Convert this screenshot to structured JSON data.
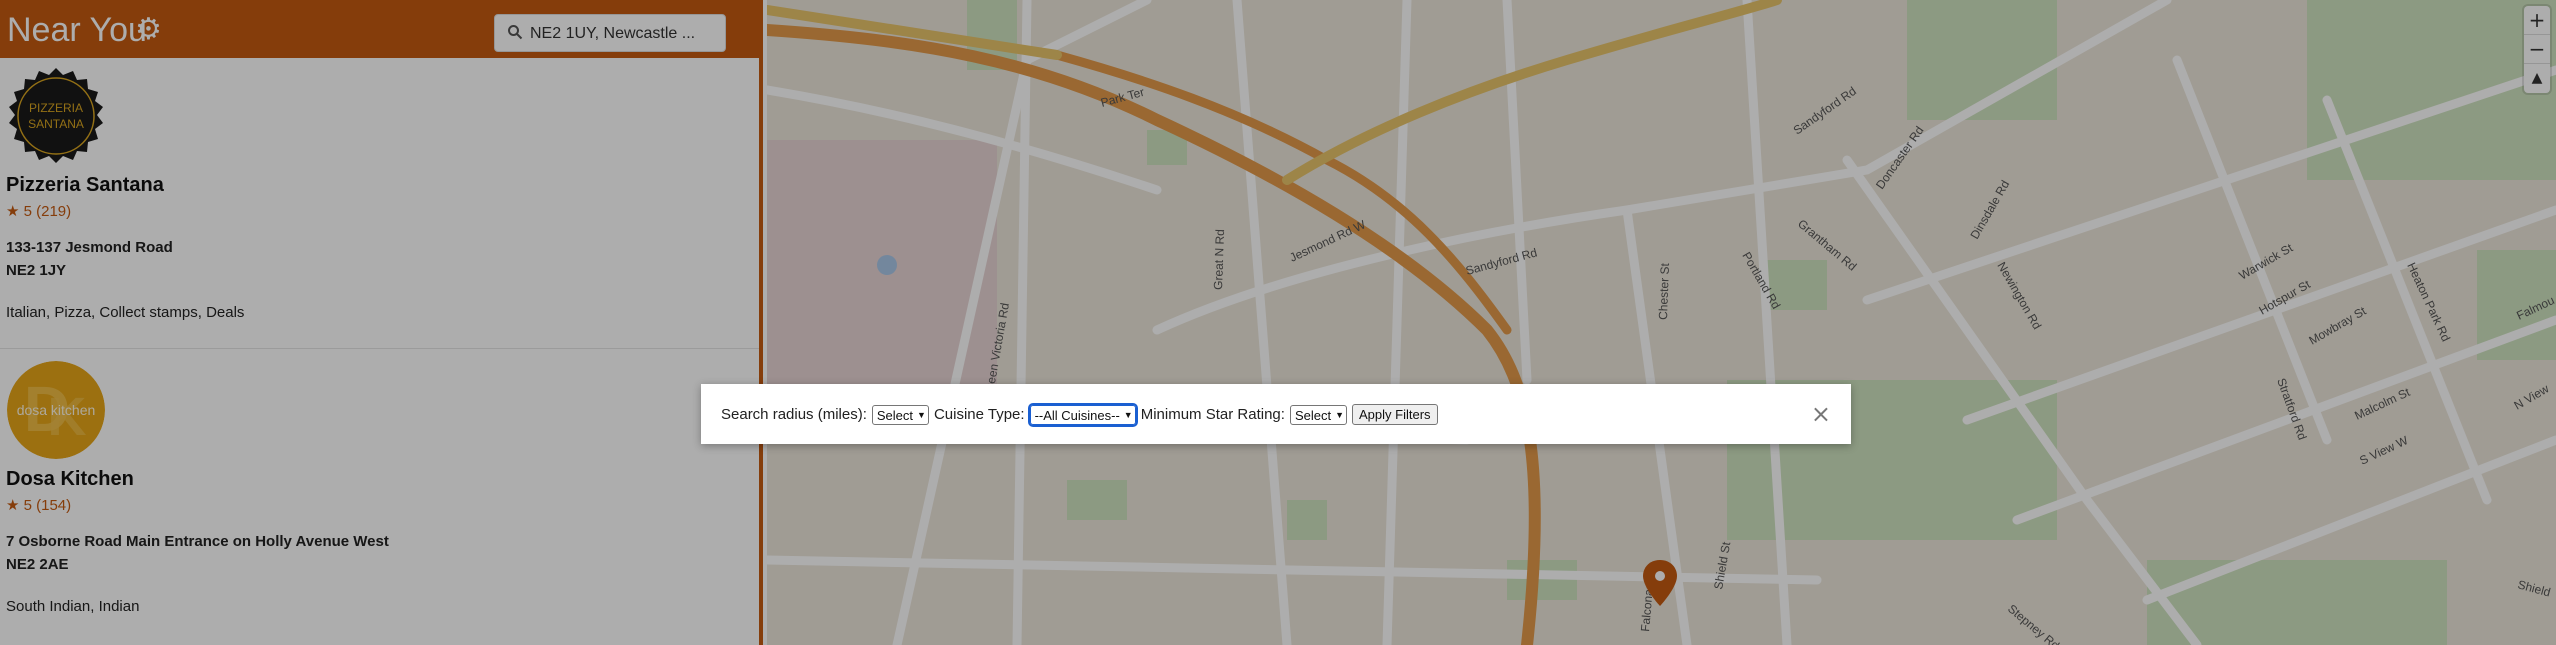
{
  "app": {
    "title": "Near You"
  },
  "search": {
    "value": "NE2 1UY, Newcastle ..."
  },
  "restaurants": [
    {
      "logo_text_1": "PIZZERIA",
      "logo_text_2": "SANTANA",
      "name": "Pizzeria Santana",
      "rating": "★ 5 (219)",
      "address": "133-137 Jesmond Road",
      "postcode": "NE2 1JY",
      "tags": "Italian, Pizza, Collect stamps, Deals"
    },
    {
      "logo_text_1": "dosa kitchen",
      "name": "Dosa Kitchen",
      "rating": "★ 5 (154)",
      "address": "7 Osborne Road Main Entrance on Holly Avenue West",
      "postcode": "NE2 2AE",
      "tags": "South Indian, Indian"
    }
  ],
  "map": {
    "zoom_in": "+",
    "zoom_out": "−",
    "compass": "▲",
    "labels": {
      "park_ter": "Park Ter",
      "great_n_rd": "Great N Rd",
      "jesmond_rd_w": "Jesmond Rd W",
      "queen_victoria_rd": "Queen Victoria Rd",
      "sandyford_rd": "Sandyford Rd",
      "sandyford_rd_2": "Sandyford Rd",
      "doncaster_rd": "Doncaster Rd",
      "grantham_rd": "Grantham Rd",
      "dinsdale_rd": "Dinsdale Rd",
      "newington_rd": "Newington Rd",
      "chester_st": "Chester St",
      "portland_rd": "Portland Rd",
      "warwick_st": "Warwick St",
      "heaton_park_rd": "Heaton Park Rd",
      "hotspur_st": "Hotspur St",
      "mowbray_st": "Mowbray St",
      "stratford_rd": "Stratford Rd",
      "malcolm_st": "Malcolm St",
      "s_view_w": "S View W",
      "n_view": "N View",
      "falmouth": "Falmou",
      "shield_st": "Shield St",
      "falconar_st": "Falconar St",
      "stepney_rd": "Stepney Rd",
      "shield": "Shield"
    }
  },
  "filters": {
    "radius_label": "Search radius (miles):",
    "radius_value": "Select",
    "cuisine_label": "Cuisine Type:",
    "cuisine_value": "--All Cuisines--",
    "rating_label": "Minimum Star Rating:",
    "rating_value": "Select",
    "apply_label": "Apply Filters",
    "close_label": "×"
  },
  "colors": {
    "brand": "#c55a11",
    "accent_focus": "#1a5fd1"
  }
}
